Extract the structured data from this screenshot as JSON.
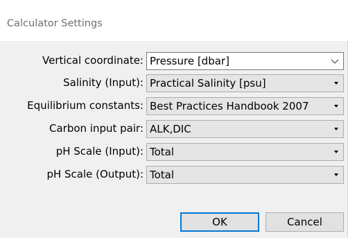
{
  "dialog": {
    "title": "Calculator Settings"
  },
  "fields": [
    {
      "label": "Vertical coordinate:",
      "value": "Pressure [dbar]",
      "editable": true
    },
    {
      "label": "Salinity (Input):",
      "value": "Practical Salinity [psu]",
      "editable": false
    },
    {
      "label": "Equilibrium constants:",
      "value": "Best Practices Handbook 2007",
      "editable": false
    },
    {
      "label": "Carbon input pair:",
      "value": "ALK,DIC",
      "editable": false
    },
    {
      "label": "pH Scale (Input):",
      "value": "Total",
      "editable": false
    },
    {
      "label": "pH Scale (Output):",
      "value": "Total",
      "editable": false
    }
  ],
  "buttons": {
    "ok": "OK",
    "cancel": "Cancel"
  },
  "icons": {
    "dropdown_editable": "chevron-down-icon",
    "dropdown": "dropdown-arrow-icon"
  },
  "colors": {
    "focus_border": "#0078d7",
    "button_bg": "#e1e1e1",
    "window_bg": "#f0f0f0"
  }
}
